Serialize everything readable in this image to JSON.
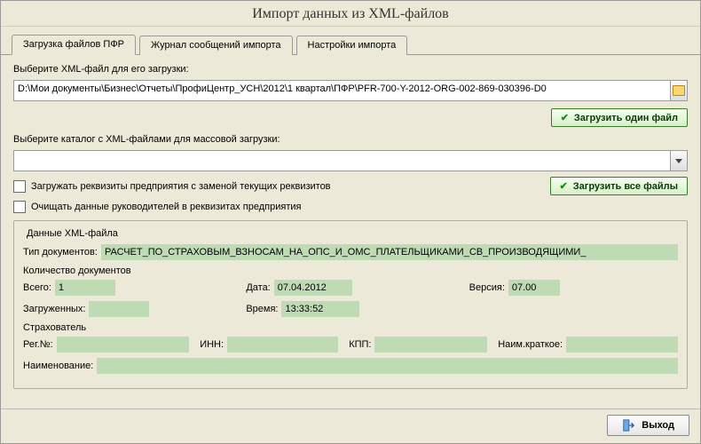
{
  "window": {
    "title": "Импорт данных из XML-файлов"
  },
  "tabs": {
    "t0": "Загрузка файлов ПФР",
    "t1": "Журнал сообщений импорта",
    "t2": "Настройки импорта"
  },
  "file_select": {
    "label": "Выберите XML-файл для его загрузки:",
    "path": "D:\\Мои документы\\Бизнес\\Отчеты\\ПрофиЦентр_УСН\\2012\\1 квартал\\ПФР\\PFR-700-Y-2012-ORG-002-869-030396-D0"
  },
  "buttons": {
    "load_one": "Загрузить один файл",
    "load_all": "Загрузить все файлы",
    "exit": "Выход"
  },
  "catalog_select": {
    "label": "Выберите каталог с XML-файлами для массовой загрузки:",
    "path": ""
  },
  "options": {
    "replace_req": "Загружать реквизиты предприятия с заменой текущих реквизитов",
    "clear_mgr": "Очищать данные руководителей в реквизитах предприятия"
  },
  "xml_data": {
    "legend": "Данные XML-файла",
    "type_label": "Тип документов:",
    "type_value": "РАСЧЕТ_ПО_СТРАХОВЫМ_ВЗНОСАМ_НА_ОПС_И_ОМС_ПЛАТЕЛЬЩИКАМИ_СВ_ПРОИЗВОДЯЩИМИ_",
    "count_label": "Количество документов",
    "total_label": "Всего:",
    "total_value": "1",
    "date_label": "Дата:",
    "date_value": "07.04.2012",
    "version_label": "Версия:",
    "version_value": "07.00",
    "loaded_label": "Загруженных:",
    "loaded_value": "",
    "time_label": "Время:",
    "time_value": "13:33:52",
    "insurer_label": "Страхователь",
    "regno_label": "Рег.№:",
    "regno_value": "",
    "inn_label": "ИНН:",
    "inn_value": "",
    "kpp_label": "КПП:",
    "kpp_value": "",
    "shortname_label": "Наим.краткое:",
    "shortname_value": "",
    "name_label": "Наименование:",
    "name_value": ""
  }
}
